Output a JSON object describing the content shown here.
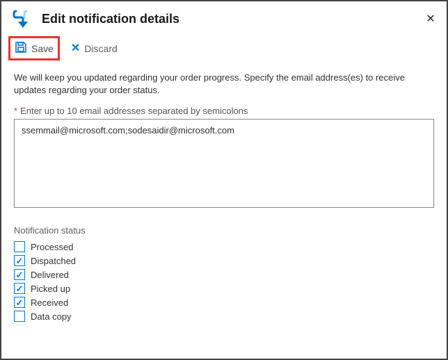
{
  "header": {
    "title": "Edit notification details"
  },
  "toolbar": {
    "save_label": "Save",
    "discard_label": "Discard"
  },
  "body": {
    "description": "We will keep you updated regarding your order progress. Specify the email address(es) to receive updates regarding your order status.",
    "email_label": "Enter up to 10 email addresses separated by semicolons",
    "email_value": "ssemmail@microsoft.com;sodesaidir@microsoft.com",
    "status_section_label": "Notification status",
    "statuses": [
      {
        "label": "Processed",
        "checked": false
      },
      {
        "label": "Dispatched",
        "checked": true
      },
      {
        "label": "Delivered",
        "checked": true
      },
      {
        "label": "Picked up",
        "checked": true
      },
      {
        "label": "Received",
        "checked": true
      },
      {
        "label": "Data copy",
        "checked": false
      }
    ]
  },
  "colors": {
    "accent": "#0078d4",
    "highlight": "#e9322e"
  }
}
